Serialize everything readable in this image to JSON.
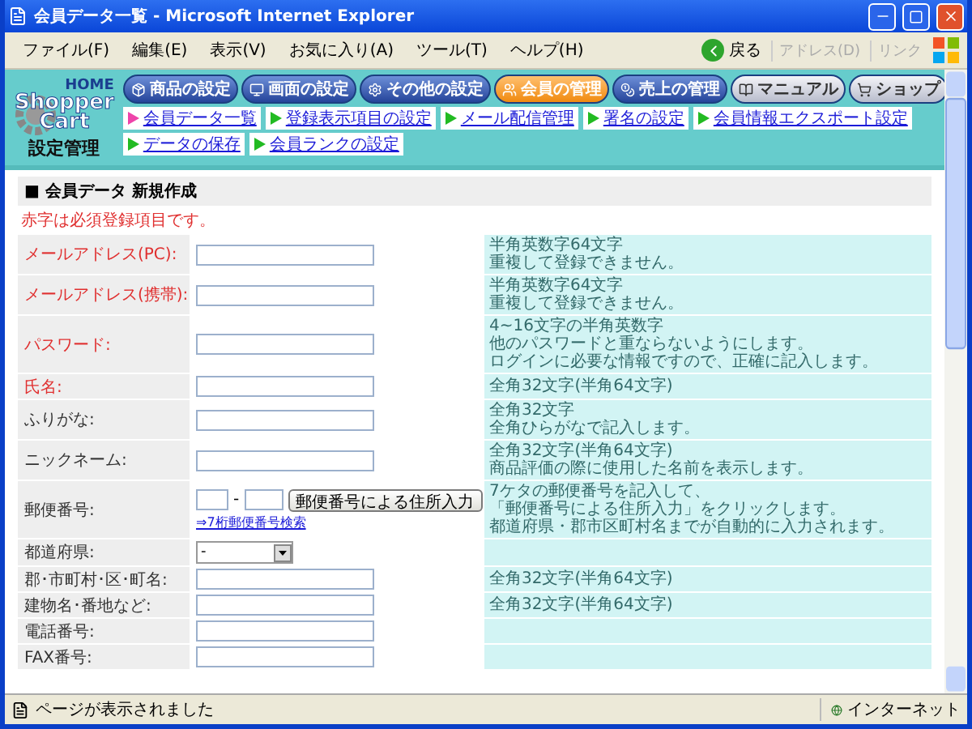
{
  "window": {
    "title": "会員データ一覧 - Microsoft Internet Explorer"
  },
  "menu_bar": {
    "items": [
      "ファイル(F)",
      "編集(E)",
      "表示(V)",
      "お気に入り(A)",
      "ツール(T)",
      "ヘルプ(H)"
    ]
  },
  "toolbar": {
    "back": "戻る",
    "address": "アドレス(D)",
    "links": "リンク"
  },
  "logo": {
    "home": "HOME",
    "line_1": "Shopper",
    "line_2": "Cart",
    "caption": "設定管理"
  },
  "nav": [
    {
      "label": "商品の設定",
      "selected": false,
      "kind": "section"
    },
    {
      "label": "画面の設定",
      "selected": false,
      "kind": "section"
    },
    {
      "label": "その他の設定",
      "selected": false,
      "kind": "section"
    },
    {
      "label": "会員の管理",
      "selected": true,
      "kind": "section"
    },
    {
      "label": "売上の管理",
      "selected": false,
      "kind": "section"
    },
    {
      "label": "マニュアル",
      "selected": false,
      "kind": "external"
    },
    {
      "label": "ショップ",
      "selected": false,
      "kind": "external"
    }
  ],
  "subnav": [
    {
      "label": "会員データ一覧",
      "selected": true
    },
    {
      "label": "登録表示項目の設定",
      "selected": false
    },
    {
      "label": "メール配信管理",
      "selected": false
    },
    {
      "label": "署名の設定",
      "selected": false
    },
    {
      "label": "会員情報エクスポート設定",
      "selected": false
    },
    {
      "label": "データの保存",
      "selected": false
    },
    {
      "label": "会員ランクの設定",
      "selected": false
    }
  ],
  "form": {
    "title": "■ 会員データ 新規作成",
    "note": "赤字は必須登録項目です。",
    "rows": [
      {
        "label": "メールアドレス(PC):",
        "required": true,
        "kind": "text",
        "hint": [
          "半角英数字64文字",
          "重複して登録できません。"
        ]
      },
      {
        "label": "メールアドレス(携帯):",
        "required": true,
        "kind": "text",
        "hint": [
          "半角英数字64文字",
          "重複して登録できません。"
        ]
      },
      {
        "label": "パスワード:",
        "required": true,
        "kind": "text",
        "hint": [
          "4~16文字の半角英数字",
          "他のパスワードと重ならないようにします。",
          "ログインに必要な情報ですので、正確に記入します。"
        ]
      },
      {
        "label": "氏名:",
        "required": true,
        "kind": "text",
        "hint": [
          "全角32文字(半角64文字)"
        ]
      },
      {
        "label": "ふりがな:",
        "required": false,
        "kind": "text",
        "hint": [
          "全角32文字",
          "全角ひらがなで記入します。"
        ]
      },
      {
        "label": "ニックネーム:",
        "required": false,
        "kind": "text",
        "hint": [
          "全角32文字(半角64文字)",
          "商品評価の際に使用した名前を表示します。"
        ]
      },
      {
        "label": "郵便番号:",
        "required": false,
        "kind": "postal",
        "separator": "-",
        "button": "郵便番号による住所入力",
        "link": "⇒7桁郵便番号検索",
        "hint": [
          "7ケタの郵便番号を記入して、",
          "「郵便番号による住所入力」をクリックします。",
          "都道府県・郡市区町村名までが自動的に入力されます。"
        ]
      },
      {
        "label": "都道府県:",
        "required": false,
        "kind": "select",
        "value": "-"
      },
      {
        "label": "郡･市町村･区･町名:",
        "required": false,
        "kind": "text",
        "hint": [
          "全角32文字(半角64文字)"
        ]
      },
      {
        "label": "建物名･番地など:",
        "required": false,
        "kind": "text",
        "hint": [
          "全角32文字(半角64文字)"
        ]
      },
      {
        "label": "電話番号:",
        "required": false,
        "kind": "text"
      },
      {
        "label": "FAX番号:",
        "required": false,
        "kind": "text"
      }
    ]
  },
  "status_bar": {
    "text": "ページが表示されました",
    "zone": "インターネット"
  }
}
